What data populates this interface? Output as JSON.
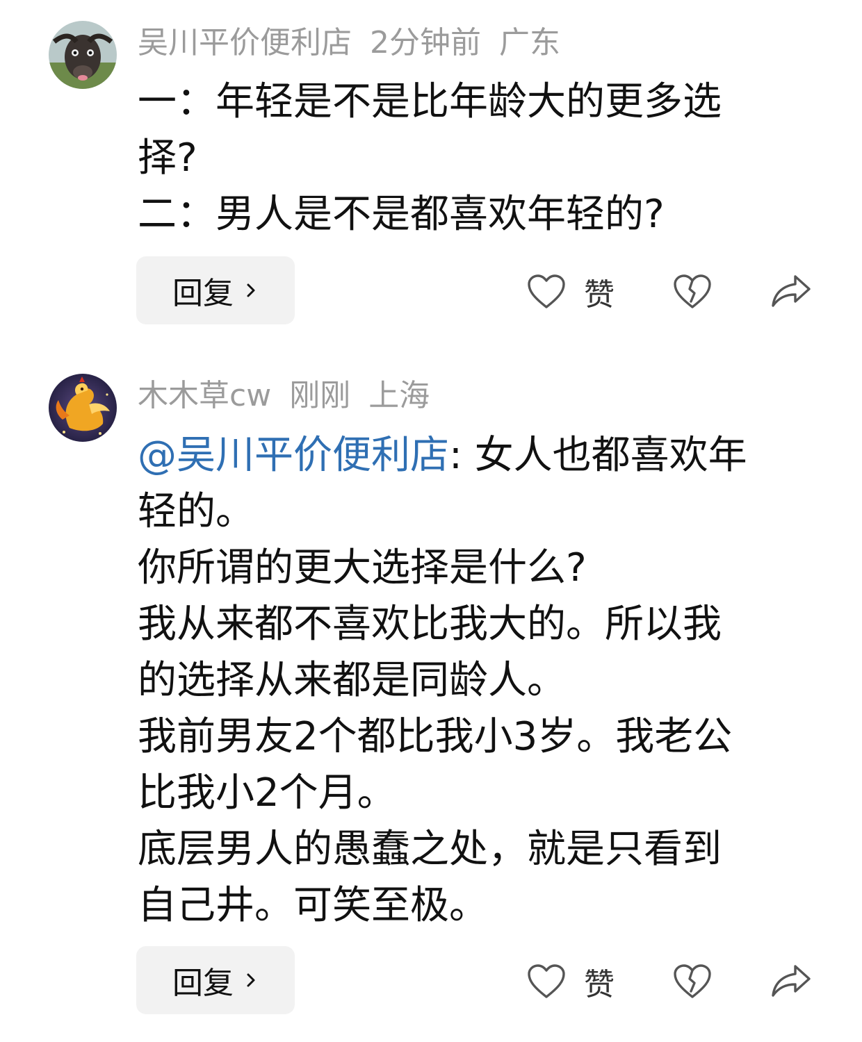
{
  "comments": [
    {
      "username": "吴川平价便利店",
      "time": "2分钟前",
      "location": "广东",
      "lines": [
        "一：年轻是不是比年龄大的更多选",
        "择?",
        "二：男人是不是都喜欢年轻的?"
      ],
      "reply_label": "回复",
      "like_label": "赞",
      "avatar_icon": "water-buffalo-avatar"
    },
    {
      "username": "木木草cw",
      "time": "刚刚",
      "location": "上海",
      "mention": "@吴川平价便利店",
      "first_line_rest": ": 女人也都喜欢年",
      "lines": [
        "轻的。",
        "你所谓的更大选择是什么?",
        "我从来都不喜欢比我大的。所以我",
        "的选择从来都是同龄人。",
        "我前男友2个都比我小3岁。我老公",
        "比我小2个月。",
        "底层男人的愚蠢之处，就是只看到",
        "自己井。可笑至极。"
      ],
      "reply_label": "回复",
      "like_label": "赞",
      "avatar_icon": "golden-phoenix-avatar"
    }
  ],
  "colors": {
    "meta_gray": "#9b9b9b",
    "mention_blue": "#2f6fb3",
    "reply_bg": "#f2f2f2",
    "icon_stroke": "#555555"
  },
  "icons": [
    "heart-icon",
    "broken-heart-icon",
    "share-icon",
    "chevron-right-icon"
  ]
}
